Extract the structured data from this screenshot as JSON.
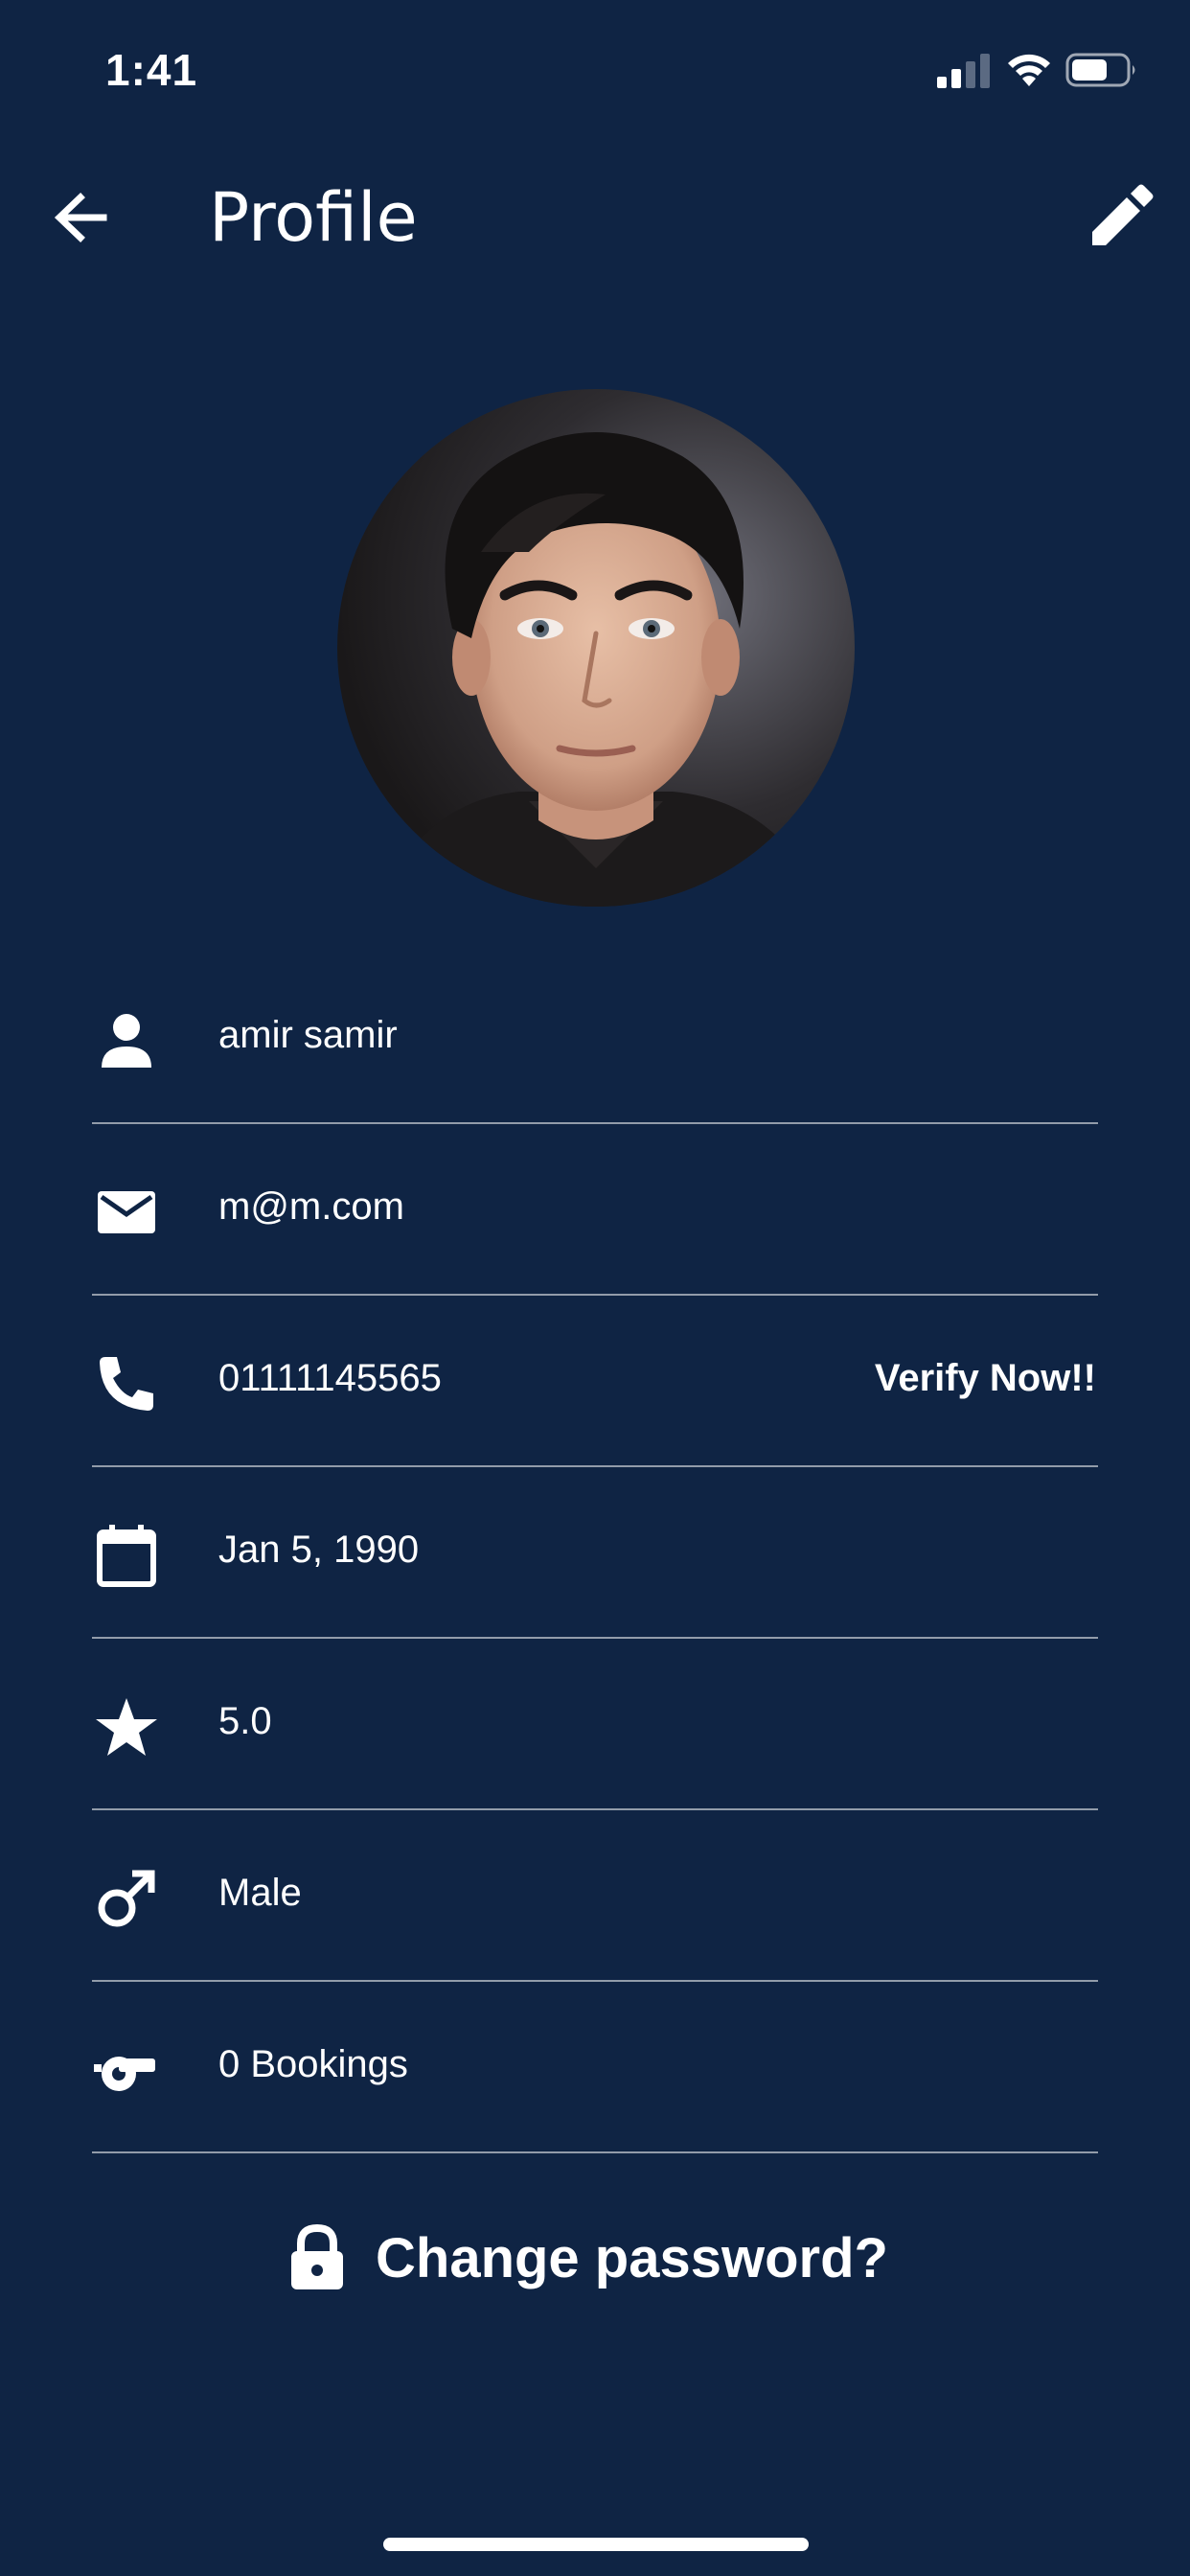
{
  "status_bar": {
    "time": "1:41",
    "signal_icon": "cellular-signal-icon",
    "wifi_icon": "wifi-icon",
    "battery_icon": "battery-icon"
  },
  "header": {
    "title": "Profile",
    "back_icon": "arrow-left-icon",
    "edit_icon": "pencil-icon"
  },
  "profile": {
    "name": "amir samir",
    "email": "m@m.com",
    "phone": "01111145565",
    "verify_label": "Verify Now!!",
    "birthdate": "Jan 5, 1990",
    "rating": "5.0",
    "gender": "Male",
    "bookings": "0 Bookings"
  },
  "actions": {
    "change_password": "Change password?"
  },
  "colors": {
    "background": "#0f2444",
    "text": "#ffffff",
    "divider": "#8c98ab"
  }
}
